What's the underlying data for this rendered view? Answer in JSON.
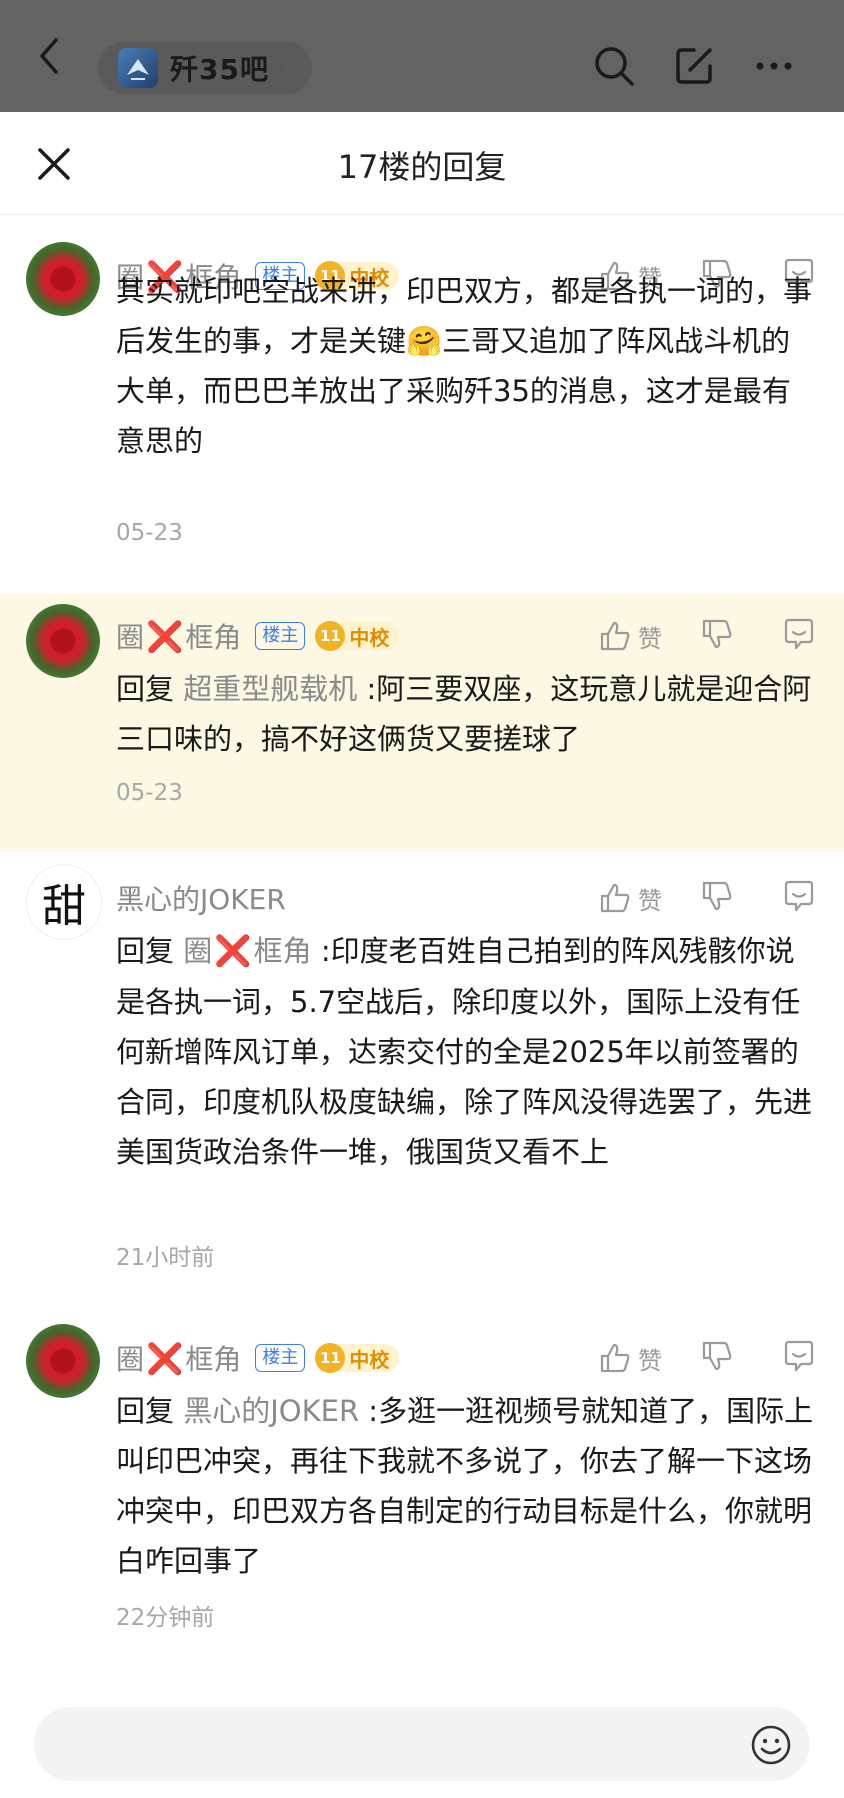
{
  "header": {
    "forum_name": "歼35吧",
    "back_icon": "back-arrow-icon",
    "search_icon": "search-icon",
    "edit_icon": "edit-icon",
    "more_icon": "more-icon"
  },
  "title_bar": {
    "title": "17楼的回复",
    "close_icon": "close-icon"
  },
  "comments": [
    {
      "username": "圈❌框角",
      "owner_badge": "楼主",
      "level": "11",
      "level_title": "中校",
      "like_label": "赞",
      "text": "其实就印吧空战来讲，印巴双方，都是各执一词的，事后发生的事，才是关键🤗三哥又追加了阵风战斗机的大单，而巴巴羊放出了采购歼35的消息，这才是最有意思的",
      "time": "05-23"
    },
    {
      "username": "圈❌框角",
      "owner_badge": "楼主",
      "level": "11",
      "level_title": "中校",
      "like_label": "赞",
      "reply_prefix": "回复 ",
      "reply_target": "超重型舰载机",
      "text": " :阿三要双座，这玩意儿就是迎合阿三口味的，搞不好这俩货又要搓球了",
      "time": "05-23"
    },
    {
      "username": "黑心的JOKER",
      "avatar_char": "甜",
      "like_label": "赞",
      "reply_prefix": "回复 ",
      "reply_target": "圈❌框角",
      "text": " :印度老百姓自己拍到的阵风残骸你说是各执一词，5.7空战后，除印度以外，国际上没有任何新增阵风订单，达索交付的全是2025年以前签署的合同，印度机队极度缺编，除了阵风没得选罢了，先进美国货政治条件一堆，俄国货又看不上",
      "time": "21小时前"
    },
    {
      "username": "圈❌框角",
      "owner_badge": "楼主",
      "level": "11",
      "level_title": "中校",
      "like_label": "赞",
      "reply_prefix": "回复 ",
      "reply_target": "黑心的JOKER",
      "text": " :多逛一逛视频号就知道了，国际上叫印巴冲突，再往下我就不多说了，你去了解一下这场冲突中，印巴双方各自制定的行动目标是什么，你就明白咋回事了",
      "time": "22分钟前"
    }
  ],
  "composer": {
    "emoji_icon": "emoji-icon"
  }
}
